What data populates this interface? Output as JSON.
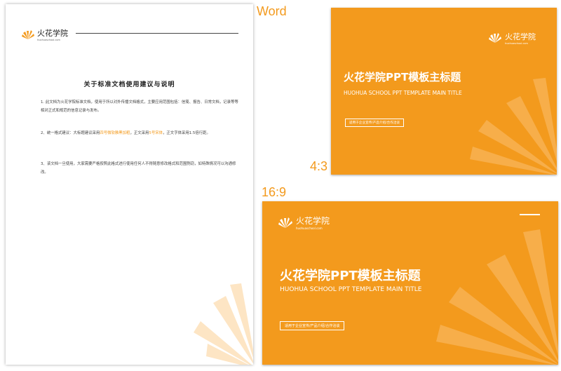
{
  "labels": {
    "word": "Word",
    "ratio_43": "4:3",
    "ratio_169": "16:9"
  },
  "brand": {
    "name": "火花学院",
    "site": "huohuaschool.com"
  },
  "doc": {
    "title": "关于标准文档使用建议与说明",
    "para1": "1. 此文档为火花学院标准文档，使用于所以对外传播文档格式，主要应用范围包括：信笺、报告、日常文档，记录等等相对正式和规范的信息记录与发布。",
    "para2_a": "2、统一格式建议：大标题建议采用",
    "para2_hl1": "四号微软雅黑加粗",
    "para2_b": "，正文采用",
    "para2_hl2": "5号宋体",
    "para2_c": "，正文字体采用1.5倍行距。",
    "para3": "3、该文档一旦使用，大家需要严格按照此格式进行使用任何人不得随意修改格式和范围剽窃，如特殊情况可以沟通修改。"
  },
  "slide": {
    "title": "火花学院PPT模板主标题",
    "subtitle": "HUOHUA SCHOOL PPT TEMPLATE MAIN TITLE",
    "tag": "适用于企业宣传/产品介绍/合作洽谈"
  },
  "colors": {
    "accent": "#f39a1d",
    "deco": "#fbc27a"
  }
}
